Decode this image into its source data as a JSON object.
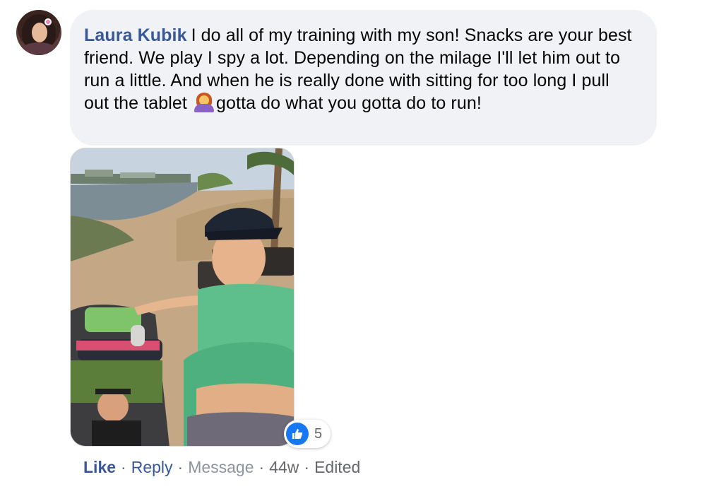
{
  "comment": {
    "author": "Laura Kubik",
    "text_part1": "I do all of my training with my son! Snacks are your best friend. We play I spy a lot. Depending on the milage I'll let him out to run a little. And when he is really done with sitting for too long I pull out the tablet ",
    "emoji": "person-shrugging-emoji",
    "text_part2": "gotta do what you gotta do to run!",
    "photo": "selfie of a woman in a visor and green tank top with a child in a stroller on a waterfront path",
    "reactions": {
      "icon": "thumbs-up-icon",
      "count": "5"
    }
  },
  "actions": {
    "like": "Like",
    "reply": "Reply",
    "message": "Message",
    "time": "44w",
    "edited": "Edited",
    "separator": "·"
  },
  "colors": {
    "author": "#385898",
    "bubble": "#f0f2f5",
    "like_blue": "#1877f2",
    "meta_gray": "#65676b"
  }
}
